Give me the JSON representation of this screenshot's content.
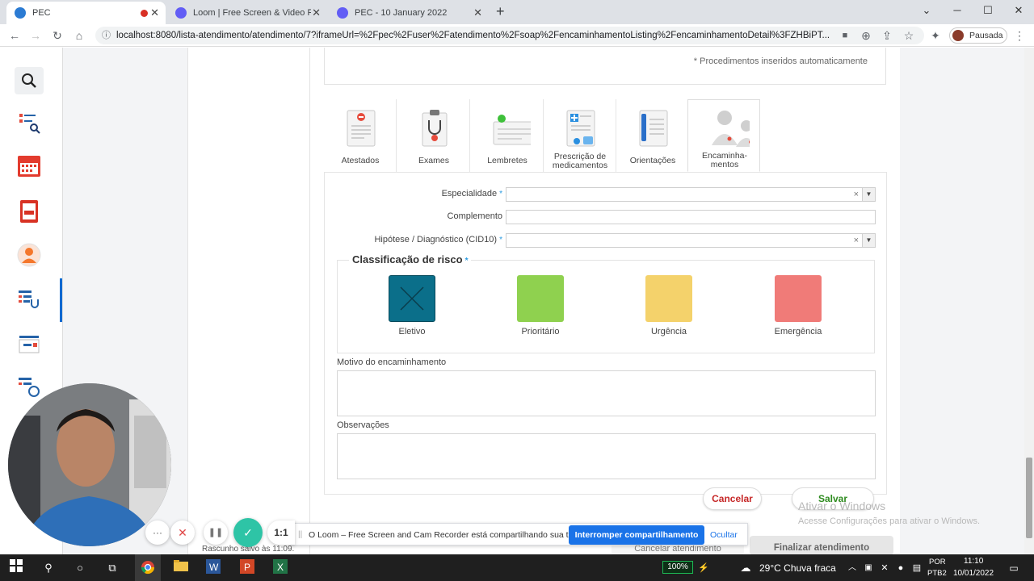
{
  "browser": {
    "tabs": [
      {
        "title": "PEC",
        "active": true,
        "recording": true
      },
      {
        "title": "Loom | Free Screen & Video Recor",
        "active": false
      },
      {
        "title": "PEC - 10 January 2022",
        "active": false
      }
    ],
    "new_tab": "+",
    "url": "localhost:8080/lista-atendimento/atendimento/7?iframeUrl=%2Fpec%2Fuser%2Fatendimento%2Fsoap%2FencaminhamentoListing%2FencaminhamentoDetail%3FZHBiPT...",
    "profile_label": "Pausada"
  },
  "proc_note": "* Procedimentos inseridos automaticamente",
  "tools": [
    {
      "label": "Atestados",
      "icon": "certificate-icon"
    },
    {
      "label": "Exames",
      "icon": "clipboard-stethoscope-icon"
    },
    {
      "label": "Lembretes",
      "icon": "reminder-icon"
    },
    {
      "label": "Prescrição de medicamentos",
      "icon": "prescription-icon"
    },
    {
      "label": "Orientações",
      "icon": "guidelines-icon"
    },
    {
      "label": "Encaminha-mentos",
      "icon": "referral-doctors-icon",
      "active": true
    }
  ],
  "form": {
    "especialidade_label": "Especialidade",
    "complemento_label": "Complemento",
    "hipotese_label": "Hipótese / Diagnóstico (CID10)",
    "required_mark": "*",
    "clear_mark": "×",
    "dropdown_mark": "▼",
    "risk_title": "Classificação de risco",
    "risks": [
      {
        "label": "Eletivo",
        "color": "#0b6f8a",
        "selected": true
      },
      {
        "label": "Prioritário",
        "color": "#8fd14f",
        "selected": false
      },
      {
        "label": "Urgência",
        "color": "#f4d26b",
        "selected": false
      },
      {
        "label": "Emergência",
        "color": "#f07b78",
        "selected": false
      }
    ],
    "motivo_label": "Motivo do encaminhamento",
    "observacoes_label": "Observações",
    "cancel_label": "Cancelar",
    "save_label": "Salvar"
  },
  "footer": {
    "cancel_attendance": "Cancelar atendimento",
    "finish_attendance": "Finalizar atendimento",
    "draft_saved": "Rascunho salvo às 11:09."
  },
  "share_bar": {
    "message": "O Loom – Free Screen and Cam Recorder está compartilhando sua tela.",
    "stop_label": "Interromper compartilhamento",
    "hide_label": "Ocultar"
  },
  "loom": {
    "more": "···",
    "cancel": "✕",
    "pause": "❚❚",
    "done": "✓",
    "timer": "1:1"
  },
  "windows": {
    "activate_title": "Ativar o Windows",
    "activate_sub": "Acesse Configurações para ativar o Windows."
  },
  "taskbar": {
    "battery": "100%",
    "weather": "29°C  Chuva fraca",
    "lang_top": "POR",
    "lang_bottom": "PTB2",
    "time": "11:10",
    "date": "10/01/2022"
  }
}
